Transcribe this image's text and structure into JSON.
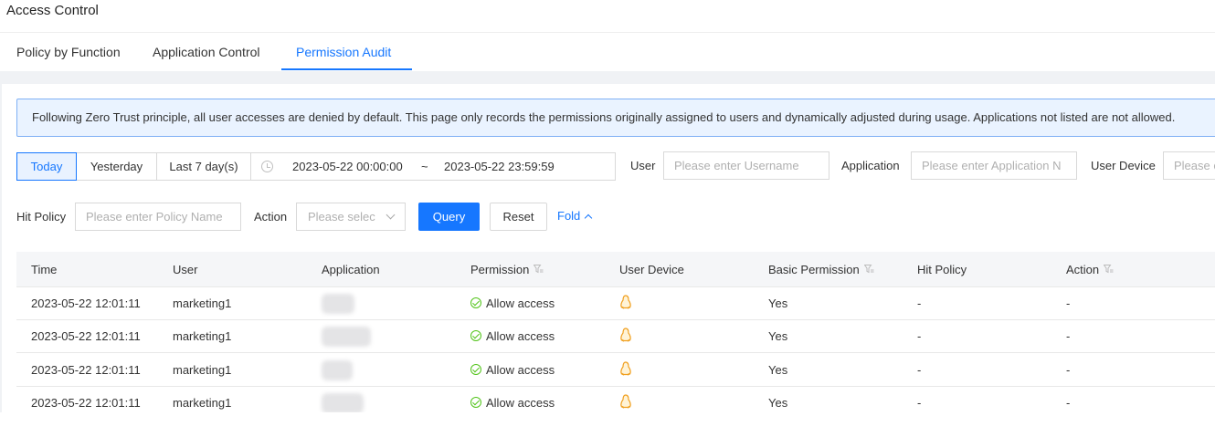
{
  "page": {
    "title": "Access Control"
  },
  "tabs": [
    {
      "label": "Policy by Function",
      "active": false
    },
    {
      "label": "Application Control",
      "active": false
    },
    {
      "label": "Permission Audit",
      "active": true
    }
  ],
  "notice": "Following Zero Trust principle, all user accesses are denied by default. This page only records the permissions originally assigned to users and dynamically adjusted during usage. Applications not listed are not allowed.",
  "filters": {
    "range_buttons": [
      "Today",
      "Yesterday",
      "Last 7 day(s)"
    ],
    "active_range": "Today",
    "date_start": "2023-05-22 00:00:00",
    "date_sep": "~",
    "date_end": "2023-05-22 23:59:59",
    "user_label": "User",
    "user_placeholder": "Please enter Username",
    "application_label": "Application",
    "application_placeholder": "Please enter Application N",
    "user_device_label": "User Device",
    "user_device_placeholder": "Please e",
    "hit_policy_label": "Hit Policy",
    "hit_policy_placeholder": "Please enter Policy Name",
    "action_label": "Action",
    "action_placeholder": "Please selec",
    "query_button": "Query",
    "reset_button": "Reset",
    "fold_label": "Fold"
  },
  "table": {
    "columns": [
      "Time",
      "User",
      "Application",
      "Permission",
      "User Device",
      "Basic Permission",
      "Hit Policy",
      "Action"
    ],
    "filterable_columns": [
      "Permission",
      "Basic Permission",
      "Action"
    ],
    "rows": [
      {
        "time": "2023-05-22 12:01:11",
        "user": "marketing1",
        "permission": "Allow access",
        "device_icon": "linux-tux-icon",
        "basic_permission": "Yes",
        "hit_policy": "-",
        "action": "-"
      },
      {
        "time": "2023-05-22 12:01:11",
        "user": "marketing1",
        "permission": "Allow access",
        "device_icon": "linux-tux-icon",
        "basic_permission": "Yes",
        "hit_policy": "-",
        "action": "-"
      },
      {
        "time": "2023-05-22 12:01:11",
        "user": "marketing1",
        "permission": "Allow access",
        "device_icon": "linux-tux-icon",
        "basic_permission": "Yes",
        "hit_policy": "-",
        "action": "-"
      },
      {
        "time": "2023-05-22 12:01:11",
        "user": "marketing1",
        "permission": "Allow access",
        "device_icon": "linux-tux-icon",
        "basic_permission": "Yes",
        "hit_policy": "-",
        "action": "-"
      }
    ]
  },
  "colors": {
    "accent": "#1677ff",
    "success": "#52c41a",
    "notice_bg": "#eaf3ff",
    "notice_border": "#7fb0f5"
  }
}
